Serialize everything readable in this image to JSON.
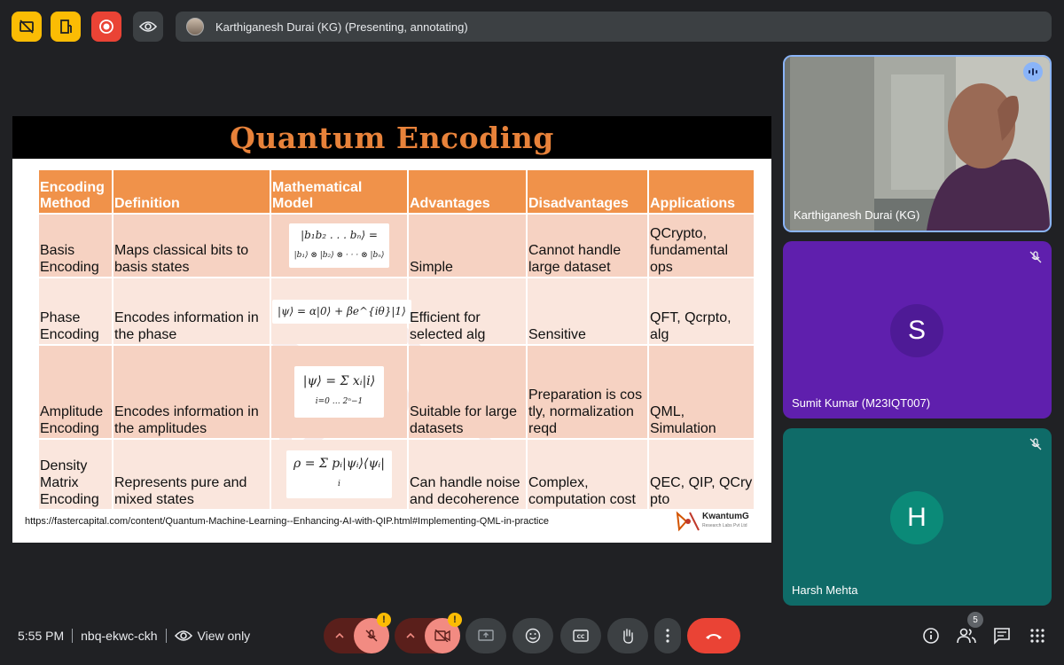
{
  "topbar": {
    "presenter_label": "Karthiganesh Durai (KG) (Presenting, annotating)"
  },
  "slide": {
    "title": "Quantum Encoding",
    "headers": [
      "Encoding Method",
      "Definition",
      "Mathematical Model",
      "Advantages",
      "Disadvantages",
      "Applications"
    ],
    "rows": [
      {
        "method": "Basis Encoding",
        "definition": "Maps classical bits to basis states",
        "math_line1": "|b₁b₂ . . . bₙ⟩ =",
        "math_line2": "|b₁⟩ ⊗ |b₂⟩ ⊗ · · · ⊗ |bₙ⟩",
        "advantages": "Simple",
        "disadvantages": "Cannot handle large dataset",
        "applications": "QCrypto, fundamental ops"
      },
      {
        "method": "Phase Encoding",
        "definition": "Encodes information in the phase",
        "math_line1": "|ψ⟩ = α|0⟩ + βe^{iθ}|1⟩",
        "math_line2": "",
        "advantages": "Efficient for selected alg",
        "disadvantages": "Sensitive",
        "applications": "QFT, Qcrpto, alg"
      },
      {
        "method": "Amplitude Encoding",
        "definition": "Encodes information in the amplitudes",
        "math_line1": "|ψ⟩ = Σ xᵢ|i⟩",
        "math_line2": "i=0 … 2ⁿ−1",
        "advantages": "Suitable for large datasets",
        "disadvantages": "Preparation is cos tly, normalization reqd",
        "applications": "QML, Simulation"
      },
      {
        "method": "Density Matrix Encoding",
        "definition": "Represents pure and mixed states",
        "math_line1": "ρ = Σ pᵢ|ψᵢ⟩⟨ψᵢ|",
        "math_line2": "i",
        "advantages": "Can handle noise and decoherence",
        "disadvantages": "Complex, computation cost",
        "applications": "QEC, QIP, QCry pto"
      }
    ],
    "source_url": "https://fastercapital.com/content/Quantum-Machine-Learning--Enhancing-AI-with-QIP.html#Implementing-QML-in-practice",
    "logo_name": "KwantumG",
    "logo_sub": "Research Labs Pvt Ltd"
  },
  "participants": [
    {
      "name": "Karthiganesh Durai (KG)",
      "initial": "",
      "muted": false
    },
    {
      "name": "Sumit Kumar (M23IQT007)",
      "initial": "S",
      "muted": true
    },
    {
      "name": "Harsh Mehta",
      "initial": "H",
      "muted": true
    }
  ],
  "bottombar": {
    "time": "5:55 PM",
    "meeting_code": "nbq-ekwc-ckh",
    "view_mode": "View only",
    "participant_count": "5"
  },
  "colors": {
    "background": "#202124",
    "accent_yellow": "#fbbc04",
    "accent_red": "#ea4335",
    "slide_header_orange": "#f0924a",
    "tile_purple": "#5f1fad",
    "tile_teal": "#0f6b68"
  }
}
